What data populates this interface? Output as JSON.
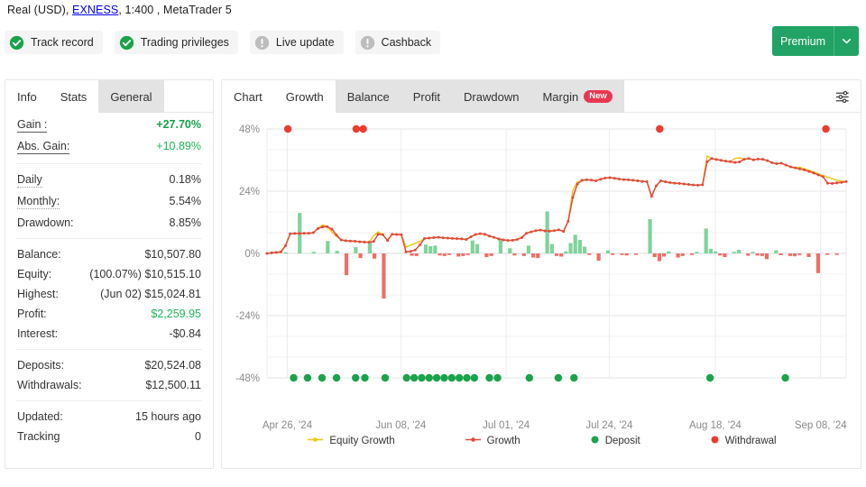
{
  "header": {
    "account_line_prefix": "Real (USD), ",
    "broker": "EXNESS",
    "account_line_suffix": ", 1:400 , MetaTrader 5",
    "account_line_full": "Real (USD), EXNESS, 1:400 , MetaTrader 5",
    "badges": [
      {
        "label": "Track record",
        "icon": "check-circle-icon",
        "state": "ok"
      },
      {
        "label": "Trading privileges",
        "icon": "check-circle-icon",
        "state": "ok"
      },
      {
        "label": "Live update",
        "icon": "exclamation-circle-icon",
        "state": "inactive"
      },
      {
        "label": "Cashback",
        "icon": "exclamation-circle-icon",
        "state": "inactive"
      }
    ],
    "premium": {
      "label": "Premium",
      "caret_icon": "chevron-down-icon"
    }
  },
  "left_panel": {
    "tabs": [
      {
        "label": "Info",
        "active": false,
        "style": "plain"
      },
      {
        "label": "Stats",
        "active": true,
        "style": "plain"
      },
      {
        "label": "General",
        "active": false,
        "style": "grey"
      }
    ],
    "groups": [
      {
        "rows": [
          {
            "key": "Gain :",
            "value": "+27.70%",
            "value_style": "green",
            "key_underline": "solid"
          },
          {
            "key": "Abs. Gain:",
            "value": "+10.89%",
            "value_style": "green-n",
            "key_underline": "solid"
          }
        ]
      },
      {
        "rows": [
          {
            "key": "Daily",
            "value": "0.18%",
            "value_style": "",
            "key_underline": "dashed"
          },
          {
            "key": "Monthly:",
            "value": "5.54%",
            "value_style": "",
            "key_underline": "dashed"
          },
          {
            "key": "Drawdown:",
            "value": "8.85%",
            "value_style": "",
            "key_underline": "none"
          }
        ]
      },
      {
        "rows": [
          {
            "key": "Balance:",
            "value": "$10,507.80",
            "prefix": "",
            "value_style": "",
            "key_underline": "none"
          },
          {
            "key": "Equity:",
            "value": "$10,515.10",
            "prefix": "(100.07%)",
            "value_style": "",
            "key_underline": "none"
          },
          {
            "key": "Highest:",
            "value": "$15,024.81",
            "prefix": "(Jun 02)",
            "value_style": "",
            "key_underline": "none"
          },
          {
            "key": "Profit:",
            "value": "$2,259.95",
            "prefix": "",
            "value_style": "green-n",
            "key_underline": "none"
          },
          {
            "key": "Interest:",
            "value": "-$0.84",
            "prefix": "",
            "value_style": "",
            "key_underline": "none"
          }
        ]
      },
      {
        "rows": [
          {
            "key": "Deposits:",
            "value": "$20,524.08",
            "value_style": "",
            "key_underline": "none"
          },
          {
            "key": "Withdrawals:",
            "value": "$12,500.11",
            "value_style": "",
            "key_underline": "none"
          }
        ]
      },
      {
        "rows": [
          {
            "key": "Updated:",
            "value": "15 hours ago",
            "value_style": "",
            "key_underline": "none"
          },
          {
            "key": "Tracking",
            "value": "0",
            "value_style": "",
            "key_underline": "none"
          }
        ]
      }
    ]
  },
  "right_panel": {
    "tabs": [
      {
        "label": "Chart",
        "active": false,
        "first": true,
        "badge": null
      },
      {
        "label": "Growth",
        "active": true,
        "first": false,
        "badge": null
      },
      {
        "label": "Balance",
        "active": false,
        "first": false,
        "badge": null
      },
      {
        "label": "Profit",
        "active": false,
        "first": false,
        "badge": null
      },
      {
        "label": "Drawdown",
        "active": false,
        "first": false,
        "badge": null
      },
      {
        "label": "Margin",
        "active": false,
        "first": false,
        "badge": "New"
      }
    ],
    "settings_icon": "sliders-icon"
  },
  "colors": {
    "growth_line": "#e04b3a",
    "equity_line": "#f5c518",
    "deposit": "#1aa34a",
    "withdrawal": "#ea3d2f",
    "bar_positive": "#7ed39a",
    "bar_negative": "#ee6f66",
    "premium": "#21a366",
    "badge_new": "#e8384f",
    "grid": "#ededed"
  },
  "chart_data": {
    "type": "line",
    "title": "Growth",
    "xlabel": "",
    "ylabel": "",
    "ylim": [
      -48,
      48
    ],
    "yticks": [
      48,
      24,
      0,
      -24,
      -48
    ],
    "ytick_labels": [
      "48%",
      "24%",
      "0%",
      "-24%",
      "-48%"
    ],
    "grid": true,
    "legend_position": "bottom",
    "xtick_labels": [
      "Apr 26, '24",
      "Jun 08, '24",
      "Jul 01, '24",
      "Jul 24, '24",
      "Aug 18, '24",
      "Sep 08, '24"
    ],
    "xtick_positions_pct": [
      3.5,
      23.1,
      41.3,
      59.1,
      77.4,
      95.6
    ],
    "series": [
      {
        "name": "Growth",
        "color": "#e04b3a",
        "values": [
          0.0,
          0.2,
          0.4,
          0.6,
          3.0,
          7.6,
          7.7,
          7.7,
          7.8,
          7.8,
          8.0,
          9.6,
          10.2,
          10.3,
          9.4,
          7.1,
          5.2,
          4.9,
          4.8,
          4.7,
          4.5,
          4.4,
          4.3,
          4.6,
          7.4,
          7.2,
          5.0,
          7.4,
          7.3,
          7.2,
          0.6,
          0.8,
          1.3,
          3.3,
          5.8,
          5.9,
          6.1,
          6.2,
          6.0,
          5.9,
          5.8,
          5.7,
          5.6,
          5.4,
          6.4,
          7.3,
          7.6,
          7.4,
          6.7,
          6.2,
          5.6,
          5.2,
          5.0,
          5.1,
          5.4,
          6.1,
          7.8,
          8.3,
          8.8,
          9.0,
          8.7,
          8.6,
          8.8,
          9.1,
          8.5,
          12.4,
          21.6,
          26.8,
          28.2,
          28.4,
          28.3,
          28.0,
          28.6,
          29.1,
          29.2,
          29.0,
          28.7,
          28.5,
          28.4,
          28.2,
          28.0,
          27.8,
          27.7,
          22.0,
          26.1,
          28.0,
          27.6,
          27.3,
          27.1,
          27.0,
          26.8,
          26.6,
          26.4,
          26.3,
          26.5,
          35.4,
          36.6,
          36.2,
          35.9,
          35.6,
          35.4,
          35.1,
          35.3,
          36.3,
          36.6,
          36.1,
          36.4,
          36.3,
          35.8,
          35.0,
          34.6,
          34.8,
          34.1,
          33.4,
          33.0,
          32.6,
          32.2,
          31.6,
          31.0,
          30.3,
          29.6,
          27.1,
          27.0,
          27.2,
          27.4,
          27.7
        ]
      },
      {
        "name": "Equity Growth",
        "color": "#f5c518",
        "values": [
          0.0,
          0.2,
          0.4,
          0.6,
          3.0,
          7.6,
          7.7,
          7.7,
          7.8,
          7.8,
          8.0,
          9.6,
          11.0,
          10.3,
          8.2,
          6.6,
          5.2,
          4.9,
          4.8,
          4.7,
          4.5,
          4.4,
          4.3,
          6.8,
          8.3,
          7.2,
          5.0,
          7.4,
          7.3,
          7.2,
          2.4,
          3.2,
          3.9,
          4.6,
          5.8,
          5.9,
          6.1,
          6.2,
          6.0,
          5.9,
          5.8,
          5.7,
          5.6,
          5.4,
          6.4,
          7.3,
          7.6,
          7.4,
          6.7,
          6.2,
          5.6,
          5.2,
          5.0,
          5.1,
          5.4,
          6.1,
          7.8,
          8.3,
          8.8,
          9.0,
          8.7,
          8.6,
          8.8,
          9.1,
          8.5,
          12.4,
          24.2,
          27.6,
          28.2,
          28.4,
          28.3,
          28.0,
          28.6,
          29.1,
          29.2,
          29.0,
          28.7,
          28.5,
          28.4,
          28.2,
          28.0,
          27.8,
          27.7,
          22.0,
          26.1,
          28.0,
          27.6,
          27.3,
          27.1,
          27.0,
          26.8,
          26.6,
          26.4,
          26.3,
          26.5,
          37.6,
          36.6,
          36.2,
          35.9,
          35.6,
          35.4,
          36.6,
          36.9,
          36.3,
          36.6,
          36.1,
          36.4,
          36.3,
          35.8,
          35.0,
          34.6,
          34.8,
          34.1,
          33.4,
          33.0,
          33.2,
          32.6,
          32.0,
          31.4,
          30.7,
          30.0,
          29.4,
          28.8,
          28.2,
          27.9,
          27.7
        ]
      }
    ],
    "bars": {
      "name": "Daily profit bars",
      "positive_color": "#7ed39a",
      "negative_color": "#ee6f66",
      "values": [
        0,
        0,
        0,
        0,
        0.4,
        0,
        0,
        15.6,
        0,
        0,
        0.6,
        0,
        0,
        4.8,
        0,
        1.0,
        0,
        -8.4,
        0,
        2.4,
        -1.8,
        0,
        4.6,
        -2.0,
        0,
        -17.4,
        0,
        0,
        0,
        0,
        0,
        -0.9,
        -1.0,
        0,
        3.4,
        2.8,
        3.0,
        -0.8,
        -1.0,
        -0.6,
        0,
        -1.2,
        -1.0,
        -0.6,
        5.0,
        3.6,
        0,
        -1.4,
        -1.0,
        0,
        5.2,
        0,
        2.0,
        -0.8,
        0,
        -1.0,
        3.0,
        -1.6,
        -1.8,
        0,
        16.2,
        3.6,
        -1.0,
        -1.2,
        0.8,
        4.0,
        7.2,
        5.2,
        2.6,
        -0.6,
        0,
        -2.8,
        0,
        1.2,
        -0.6,
        0,
        -0.6,
        -0.8,
        0,
        -0.4,
        0,
        0,
        13.2,
        -1.4,
        -3.0,
        -1.2,
        0.8,
        0,
        -1.6,
        -1.0,
        0,
        -0.6,
        0.6,
        0,
        9.6,
        1.8,
        0.8,
        -0.8,
        -1.4,
        0,
        0.6,
        1.4,
        0,
        -0.9,
        0.6,
        -0.8,
        -1.0,
        -2.2,
        0,
        1.2,
        -0.7,
        0,
        -1.0,
        -1.1,
        -0.6,
        0,
        -1.4,
        0,
        -7.6,
        0,
        -0.4,
        0,
        -0.5,
        0,
        0
      ]
    },
    "deposits": {
      "name": "Deposit",
      "color": "#1aa34a",
      "marker_y": -48,
      "x_pct": [
        4.6,
        7.0,
        9.5,
        12.0,
        15.3,
        16.9,
        20.4,
        24.1,
        25.4,
        26.7,
        28.0,
        29.3,
        30.6,
        31.9,
        33.2,
        34.5,
        35.8,
        38.4,
        39.8,
        45.3,
        50.3,
        53.0,
        76.5,
        89.5
      ]
    },
    "withdrawals": {
      "name": "Withdrawal",
      "color": "#ea3d2f",
      "marker_y": 48,
      "x_pct": [
        3.6,
        15.4,
        16.6,
        67.8,
        96.5
      ]
    },
    "legend": [
      {
        "label": "Equity Growth",
        "type": "line",
        "color": "#f5c518"
      },
      {
        "label": "Growth",
        "type": "line",
        "color": "#e04b3a"
      },
      {
        "label": "Deposit",
        "type": "dot",
        "color": "#1aa34a"
      },
      {
        "label": "Withdrawal",
        "type": "dot",
        "color": "#ea3d2f"
      }
    ]
  }
}
